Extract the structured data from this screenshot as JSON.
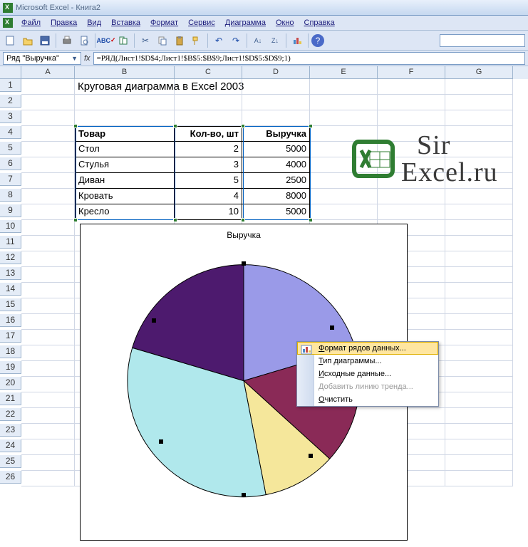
{
  "app": {
    "title": "Microsoft Excel - Книга2"
  },
  "menu": {
    "file": "Файл",
    "edit": "Правка",
    "view": "Вид",
    "insert": "Вставка",
    "format": "Формат",
    "service": "Сервис",
    "chart": "Диаграмма",
    "window": "Окно",
    "help": "Справка"
  },
  "toolbar": {
    "abc": "ABC"
  },
  "namebox": {
    "value": "Ряд \"Выручка\""
  },
  "formula": {
    "value": "=РЯД(Лист1!$D$4;Лист1!$B$5:$B$9;Лист1!$D$5:$D$9;1)"
  },
  "columns": [
    "A",
    "B",
    "C",
    "D",
    "E",
    "F",
    "G"
  ],
  "rows_visible": 26,
  "title_cell": {
    "ref": "B1",
    "text": "Круговая диаграмма в Excel 2003"
  },
  "table": {
    "headers": [
      "Товар",
      "Кол-во, шт",
      "Выручка"
    ],
    "rows": [
      {
        "name": "Стол",
        "qty": 2,
        "rev": 5000
      },
      {
        "name": "Стулья",
        "qty": 3,
        "rev": 4000
      },
      {
        "name": "Диван",
        "qty": 5,
        "rev": 2500
      },
      {
        "name": "Кровать",
        "qty": 4,
        "rev": 8000
      },
      {
        "name": "Кресло",
        "qty": 10,
        "rev": 5000
      }
    ]
  },
  "chart_data": {
    "type": "pie",
    "title": "Выручка",
    "categories": [
      "Стол",
      "Стулья",
      "Диван",
      "Кровать",
      "Кресло"
    ],
    "values": [
      5000,
      4000,
      2500,
      8000,
      5000
    ],
    "colors": [
      "#9a9ae8",
      "#8a2a57",
      "#f5e79b",
      "#b0e8ec",
      "#4d1a6e"
    ]
  },
  "context_menu": {
    "items": [
      {
        "label": "Формат рядов данных...",
        "hover": true,
        "icon": true
      },
      {
        "label": "Тип диаграммы..."
      },
      {
        "label": "Исходные данные..."
      },
      {
        "label": "Добавить линию тренда...",
        "disabled": true
      },
      {
        "label": "Очистить"
      }
    ]
  },
  "watermark": {
    "line1": "Sir",
    "line2": "Excel.ru"
  }
}
